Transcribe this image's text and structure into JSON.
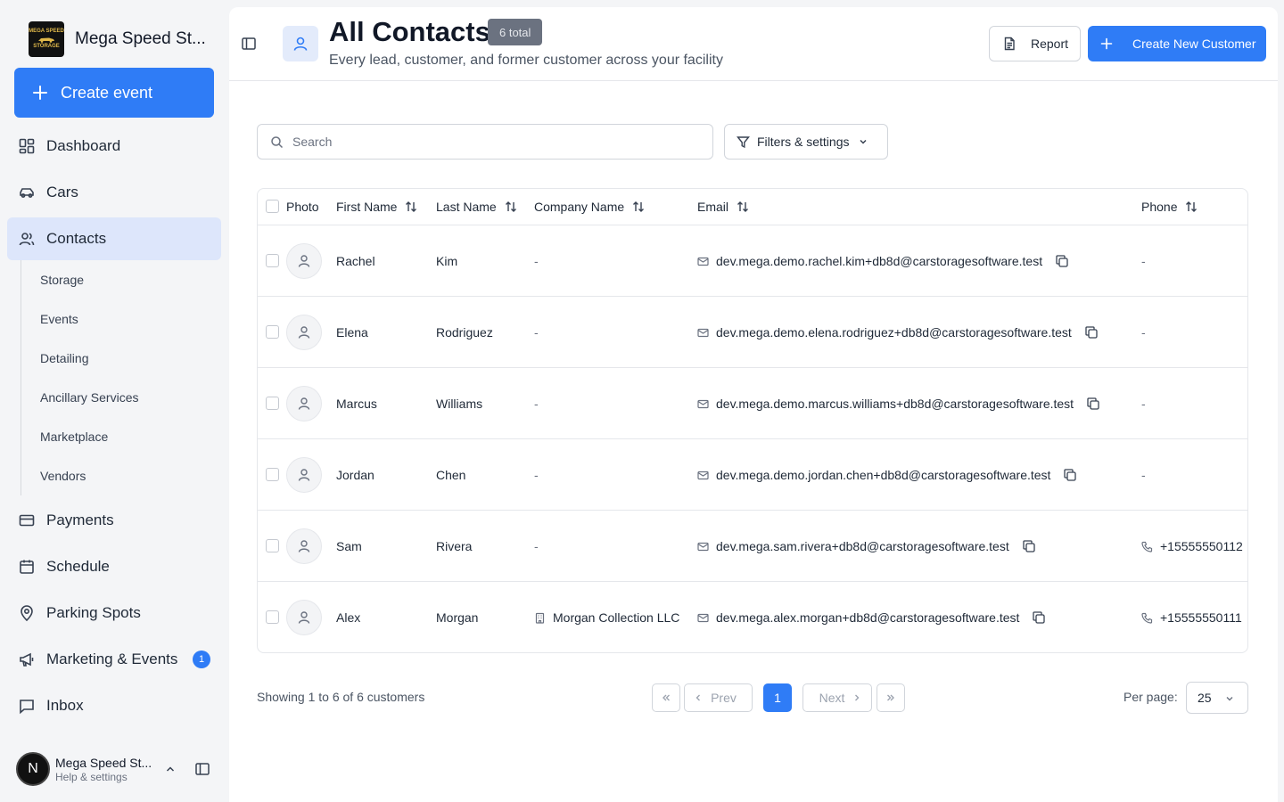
{
  "sidebar": {
    "brand_name": "Mega Speed St...",
    "logo_text_top": "MEGA SPEED",
    "logo_text_bottom": "STORAGE",
    "create_event_label": "Create event",
    "nav": {
      "dashboard": "Dashboard",
      "cars": "Cars",
      "contacts": "Contacts",
      "payments": "Payments",
      "schedule": "Schedule",
      "parking_spots": "Parking Spots",
      "marketing": "Marketing & Events",
      "marketing_badge": "1",
      "inbox": "Inbox"
    },
    "subnav": {
      "storage": "Storage",
      "events": "Events",
      "detailing": "Detailing",
      "ancillary": "Ancillary Services",
      "marketplace": "Marketplace",
      "vendors": "Vendors"
    },
    "user": {
      "initial": "N",
      "name": "Mega Speed St...",
      "sub": "Help & settings"
    }
  },
  "header": {
    "title": "All Contacts",
    "total_badge": "6 total",
    "subtitle": "Every lead, customer, and former customer across your facility",
    "report_label": "Report",
    "create_label": "Create New Customer"
  },
  "toolbar": {
    "search_placeholder": "Search",
    "filters_label": "Filters & settings"
  },
  "table": {
    "columns": {
      "photo": "Photo",
      "first_name": "First Name",
      "last_name": "Last Name",
      "company": "Company Name",
      "email": "Email",
      "phone": "Phone"
    },
    "rows": [
      {
        "first": "Rachel",
        "last": "Kim",
        "company": "-",
        "email": "dev.mega.demo.rachel.kim+db8d@carstoragesoftware.test",
        "phone": "-"
      },
      {
        "first": "Elena",
        "last": "Rodriguez",
        "company": "-",
        "email": "dev.mega.demo.elena.rodriguez+db8d@carstoragesoftware.test",
        "phone": "-"
      },
      {
        "first": "Marcus",
        "last": "Williams",
        "company": "-",
        "email": "dev.mega.demo.marcus.williams+db8d@carstoragesoftware.test",
        "phone": "-"
      },
      {
        "first": "Jordan",
        "last": "Chen",
        "company": "-",
        "email": "dev.mega.demo.jordan.chen+db8d@carstoragesoftware.test",
        "phone": "-"
      },
      {
        "first": "Sam",
        "last": "Rivera",
        "company": "-",
        "email": "dev.mega.sam.rivera+db8d@carstoragesoftware.test",
        "phone": "+15555550112"
      },
      {
        "first": "Alex",
        "last": "Morgan",
        "company": "Morgan Collection LLC",
        "email": "dev.mega.alex.morgan+db8d@carstoragesoftware.test",
        "phone": "+15555550111"
      }
    ]
  },
  "pagination": {
    "showing": "Showing 1 to 6 of 6 customers",
    "prev": "Prev",
    "next": "Next",
    "current_page": "1",
    "per_page_label": "Per page:",
    "per_page_value": "25"
  },
  "colors": {
    "accent": "#2f7cf6",
    "active_nav_bg": "#dde6fb"
  }
}
